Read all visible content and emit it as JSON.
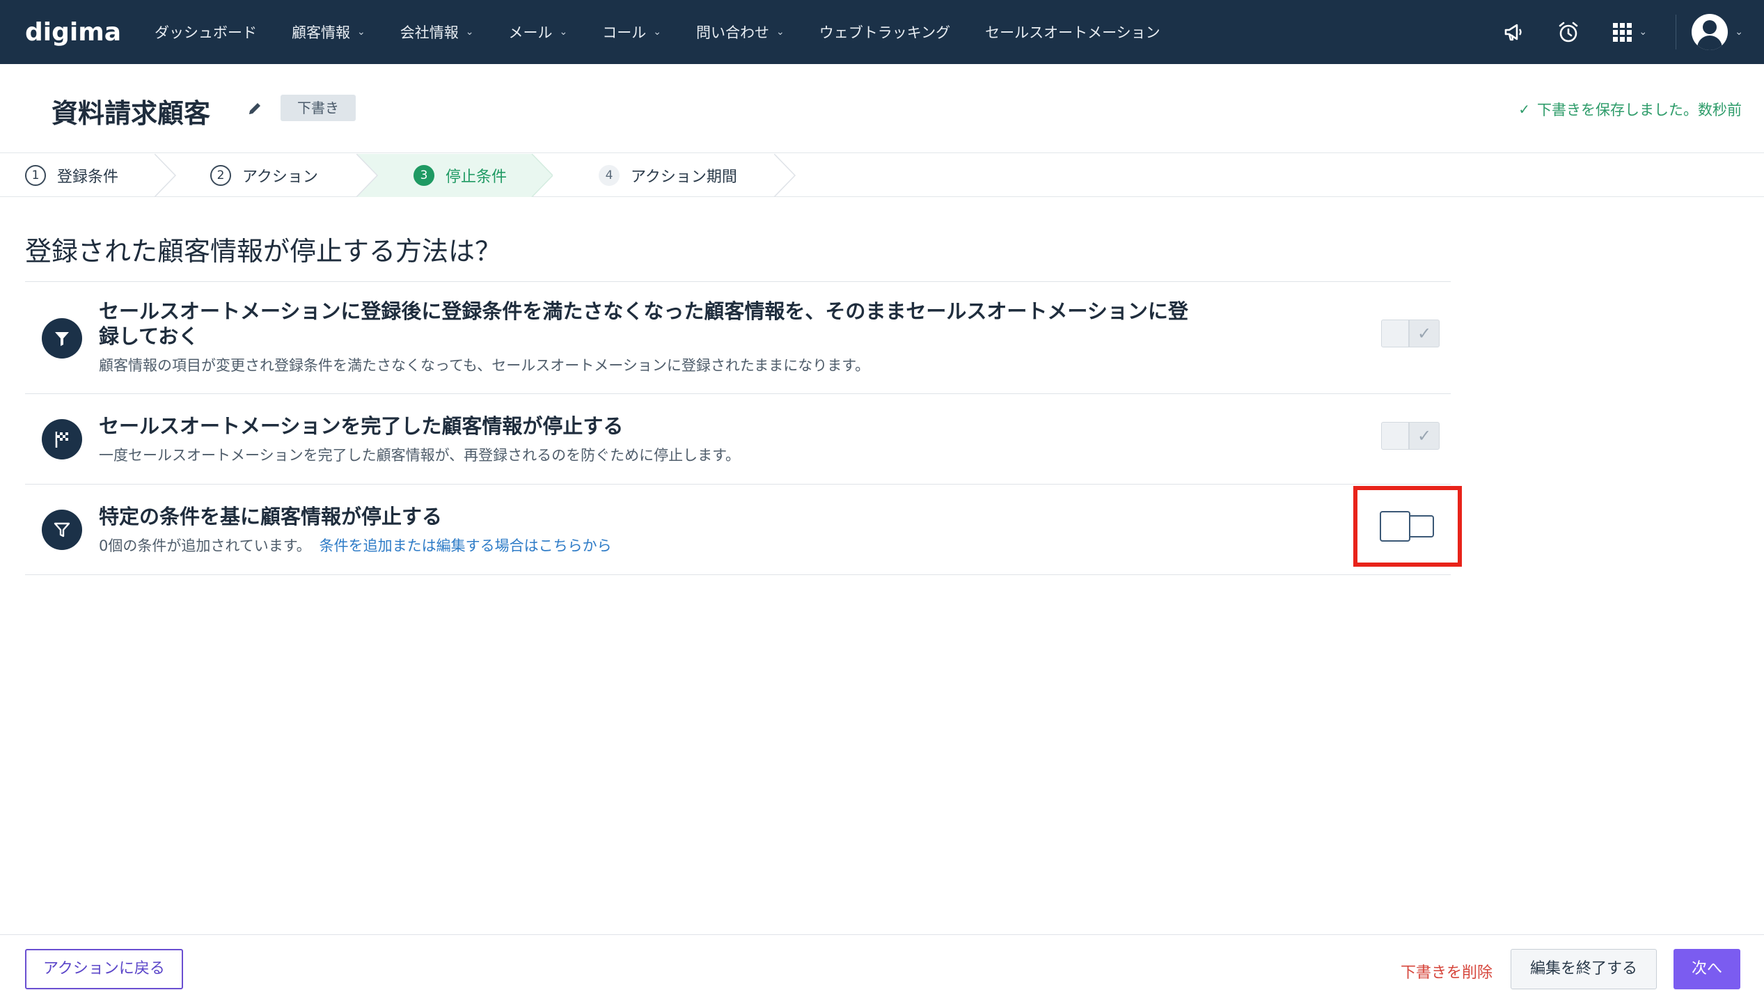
{
  "nav": {
    "logo": "digima",
    "items": [
      {
        "label": "ダッシュボード",
        "dropdown": false
      },
      {
        "label": "顧客情報",
        "dropdown": true
      },
      {
        "label": "会社情報",
        "dropdown": true
      },
      {
        "label": "メール",
        "dropdown": true
      },
      {
        "label": "コール",
        "dropdown": true
      },
      {
        "label": "問い合わせ",
        "dropdown": true
      },
      {
        "label": "ウェブトラッキング",
        "dropdown": false
      },
      {
        "label": "セールスオートメーション",
        "dropdown": false
      }
    ],
    "icons": [
      "megaphone-icon",
      "alarm-clock-icon",
      "app-grid-icon",
      "user-avatar-icon"
    ]
  },
  "header": {
    "title": "資料請求顧客",
    "status_badge": "下書き",
    "save_status": "下書きを保存しました。数秒前"
  },
  "steps": [
    {
      "number": "1",
      "label": "登録条件",
      "state": "done"
    },
    {
      "number": "2",
      "label": "アクション",
      "state": "done"
    },
    {
      "number": "3",
      "label": "停止条件",
      "state": "active"
    },
    {
      "number": "4",
      "label": "アクション期間",
      "state": "future"
    }
  ],
  "main": {
    "question": "登録された顧客情報が停止する方法は？",
    "options": [
      {
        "icon": "flag-funnel-icon",
        "title_line1": "セールスオートメーションに登録後に登録条件を満たさなくなった顧客情報を、そのままセールスオートメーションに登",
        "title_line2": "録しておく",
        "description": "顧客情報の項目が変更され登録条件を満たさなくなっても、セールスオートメーションに登録されたままになります。",
        "toggle": "off"
      },
      {
        "icon": "checkered-flag-icon",
        "title": "セールスオートメーションを完了した顧客情報が停止する",
        "description": "一度セールスオートメーションを完了した顧客情報が、再登録されるのを防ぐために停止します。",
        "toggle": "off"
      },
      {
        "icon": "filter-icon",
        "title": "特定の条件を基に顧客情報が停止する",
        "description": "0個の条件が追加されています。",
        "link": "条件を追加または編集する場合はこちらから",
        "toggle": "unset"
      }
    ]
  },
  "footer": {
    "back_label": "アクションに戻る",
    "delete_label": "下書きを削除",
    "finish_label": "編集を終了する",
    "next_label": "次へ"
  },
  "colors": {
    "nav_bg": "#1b3148",
    "accent_green": "#1f9a63",
    "primary_purple": "#7b5cf0",
    "danger": "#d6473d",
    "highlight": "#e8231a"
  }
}
